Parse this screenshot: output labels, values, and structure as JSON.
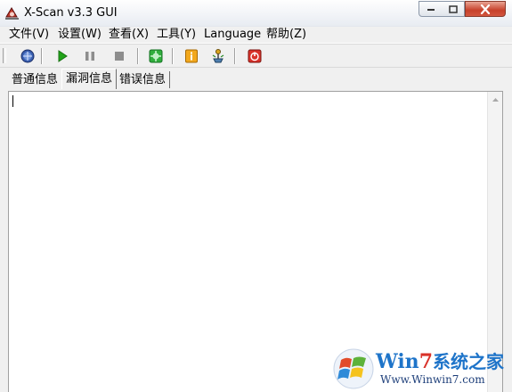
{
  "window": {
    "title": "X-Scan v3.3 GUI",
    "icons": {
      "app": "x-scan-app-icon",
      "min": "minimize-icon",
      "max": "maximize-icon",
      "close": "close-icon"
    }
  },
  "menu": {
    "items": [
      {
        "label": "文件(V)"
      },
      {
        "label": "设置(W)"
      },
      {
        "label": "查看(X)"
      },
      {
        "label": "工具(Y)"
      },
      {
        "label": "Language"
      },
      {
        "label": "帮助(Z)"
      }
    ]
  },
  "toolbar": {
    "buttons": [
      {
        "name": "globe-icon"
      },
      {
        "name": "play-icon"
      },
      {
        "name": "pause-icon"
      },
      {
        "name": "stop-icon"
      },
      {
        "name": "scan-plugin-icon"
      },
      {
        "name": "info-icon"
      },
      {
        "name": "network-tool-icon"
      },
      {
        "name": "power-icon"
      }
    ]
  },
  "tabs": [
    {
      "label": "普通信息",
      "active": false
    },
    {
      "label": "漏洞信息",
      "active": true
    },
    {
      "label": "错误信息",
      "active": false
    }
  ],
  "output": {
    "text": ""
  },
  "watermark": {
    "brand_win": "Win",
    "brand_seven": "7",
    "brand_cn": "系统之家",
    "url": "Www.Winwin7.com"
  },
  "colors": {
    "play_green": "#22a31a",
    "close_red": "#c7402a",
    "info_orange": "#f2a81d",
    "power_red": "#d9322a"
  }
}
